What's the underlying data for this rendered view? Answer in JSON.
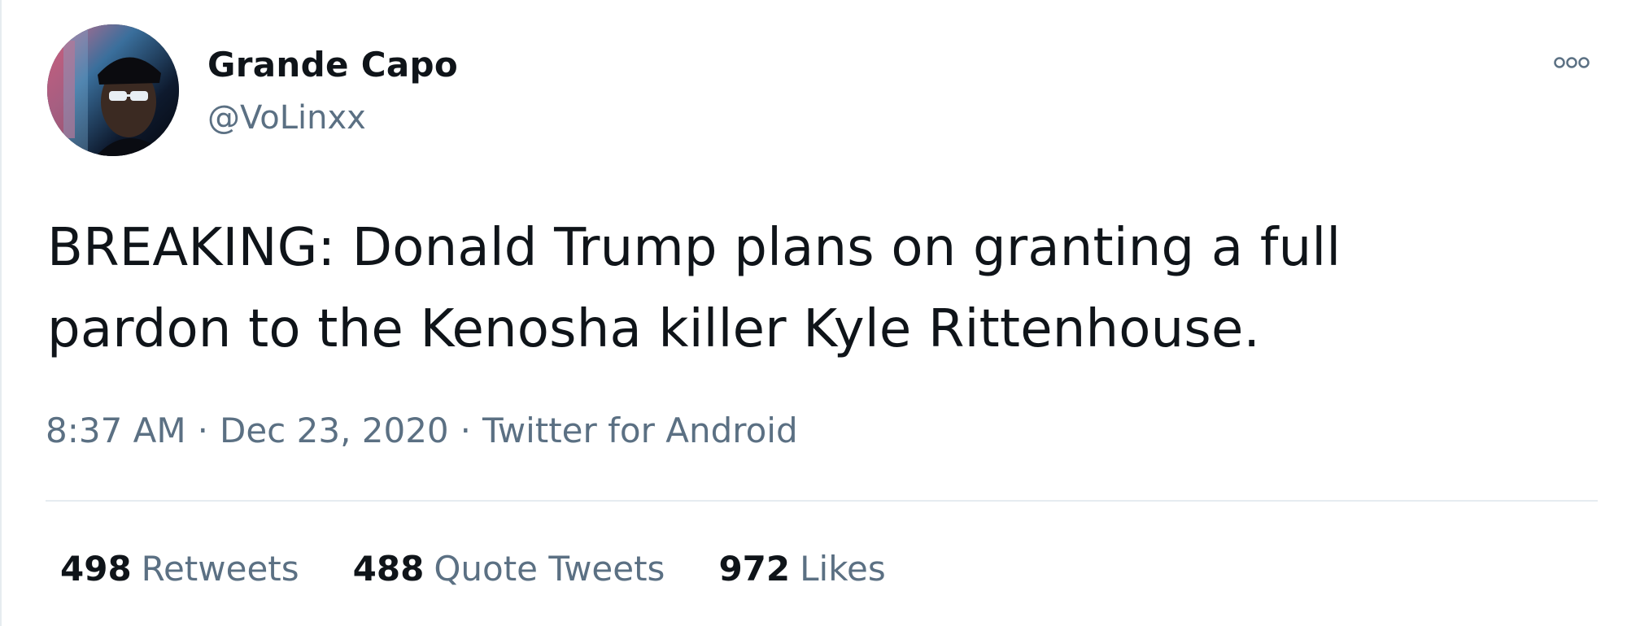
{
  "tweet": {
    "display_name": "Grande Capo",
    "handle": "@VoLinxx",
    "text": "BREAKING: Donald Trump plans on granting a full\npardon to the Kenosha killer Kyle Rittenhouse.",
    "time": "8:37 AM",
    "date": "Dec 23, 2020",
    "source": "Twitter for Android",
    "separator": "·",
    "avatar_icon": "user-avatar-photo",
    "more_icon": "more-options-icon"
  },
  "stats": {
    "retweets": {
      "count": "498",
      "label": "Retweets"
    },
    "quotes": {
      "count": "488",
      "label": "Quote Tweets"
    },
    "likes": {
      "count": "972",
      "label": "Likes"
    }
  },
  "colors": {
    "text_primary": "#0f1419",
    "text_secondary": "#5b7083",
    "divider": "#e6ecf0",
    "background": "#ffffff"
  }
}
